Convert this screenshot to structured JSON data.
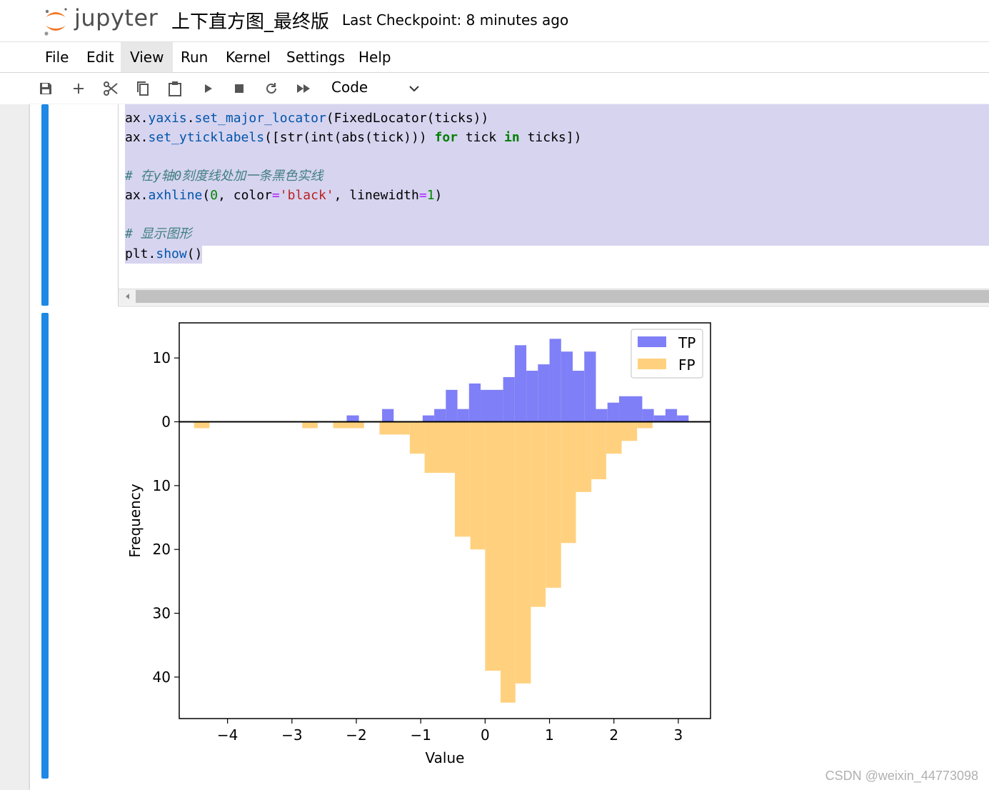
{
  "header": {
    "logo_text": "jupyter",
    "notebook_title": "上下直方图_最终版",
    "checkpoint": "Last Checkpoint: 8 minutes ago"
  },
  "menu": {
    "items": [
      {
        "label": "File"
      },
      {
        "label": "Edit"
      },
      {
        "label": "View"
      },
      {
        "label": "Run"
      },
      {
        "label": "Kernel"
      },
      {
        "label": "Settings"
      },
      {
        "label": "Help"
      }
    ]
  },
  "toolbar": {
    "icons": [
      "save-icon",
      "add-cell-icon",
      "cut-icon",
      "copy-icon",
      "paste-icon",
      "run-icon",
      "stop-icon",
      "restart-icon",
      "run-all-icon"
    ],
    "cell_type": "Code"
  },
  "code": {
    "lines": {
      "l1": {
        "a": "ax.",
        "b": "yaxis",
        "c": ".",
        "d": "set_major_locator",
        "e": "(FixedLocator(ticks))"
      },
      "l2": {
        "a": "ax.",
        "b": "set_yticklabels",
        "c": "([str(int(abs(tick))) ",
        "d": "for",
        "e": " tick ",
        "f": "in",
        "g": " ticks])"
      },
      "l3": "",
      "l4": {
        "comment": "# 在y轴0刻度线处加一条黑色实线"
      },
      "l5": {
        "a": "ax.",
        "b": "axhline",
        "c": "(",
        "d": "0",
        "e": ", color",
        "f": "=",
        "g": "'black'",
        "h": ", linewidth",
        "i": "=",
        "j": "1",
        "k": ")"
      },
      "l6": "",
      "l7": {
        "comment": "# 显示图形"
      },
      "l8": {
        "a": "plt.",
        "b": "show",
        "c": "()"
      }
    }
  },
  "chart_data": {
    "type": "bar",
    "xlabel": "Value",
    "ylabel": "Frequency",
    "xlim": [
      -4.75,
      3.5
    ],
    "ylim": [
      -46.5,
      15.5
    ],
    "xticks": [
      -4,
      -3,
      -2,
      -1,
      0,
      1,
      2,
      3
    ],
    "xticklabels": [
      "−4",
      "−3",
      "−2",
      "−1",
      "0",
      "1",
      "2",
      "3"
    ],
    "yticks": [
      10,
      0,
      -10,
      -20,
      -30,
      -40
    ],
    "yticklabels": [
      "10",
      "0",
      "10",
      "20",
      "30",
      "40"
    ],
    "legend": {
      "position": "top-right",
      "entries": [
        "TP",
        "FP"
      ]
    },
    "series": [
      {
        "name": "TP",
        "color": "#7f7ff7",
        "bins": [
          [
            -2.15,
            -1.96,
            1
          ],
          [
            -1.6,
            -1.42,
            2
          ],
          [
            -0.97,
            -0.79,
            1
          ],
          [
            -0.79,
            -0.61,
            2
          ],
          [
            -0.61,
            -0.43,
            5
          ],
          [
            -0.43,
            -0.25,
            2
          ],
          [
            -0.25,
            -0.07,
            6
          ],
          [
            -0.07,
            0.28,
            5
          ],
          [
            0.28,
            0.46,
            7
          ],
          [
            0.46,
            0.64,
            12
          ],
          [
            0.64,
            0.82,
            8
          ],
          [
            0.82,
            1.0,
            9
          ],
          [
            1.0,
            1.18,
            13
          ],
          [
            1.18,
            1.36,
            11
          ],
          [
            1.36,
            1.54,
            8
          ],
          [
            1.54,
            1.72,
            11
          ],
          [
            1.72,
            1.9,
            2
          ],
          [
            1.9,
            2.08,
            3
          ],
          [
            2.08,
            2.44,
            4
          ],
          [
            2.44,
            2.62,
            2
          ],
          [
            2.62,
            2.8,
            1
          ],
          [
            2.8,
            2.98,
            2
          ],
          [
            2.98,
            3.16,
            1
          ]
        ]
      },
      {
        "name": "FP",
        "color": "#ffd17f",
        "bins": [
          [
            -4.52,
            -4.28,
            -1
          ],
          [
            -2.84,
            -2.6,
            -1
          ],
          [
            -2.36,
            -1.88,
            -1
          ],
          [
            -1.64,
            -1.17,
            -2
          ],
          [
            -1.17,
            -0.94,
            -5
          ],
          [
            -0.94,
            -0.47,
            -8
          ],
          [
            -0.47,
            -0.23,
            -18
          ],
          [
            -0.23,
            0.0,
            -20
          ],
          [
            0.0,
            0.24,
            -39
          ],
          [
            0.24,
            0.47,
            -44
          ],
          [
            0.47,
            0.71,
            -41
          ],
          [
            0.71,
            0.94,
            -29
          ],
          [
            0.94,
            1.18,
            -26
          ],
          [
            1.18,
            1.41,
            -19
          ],
          [
            1.41,
            1.65,
            -11
          ],
          [
            1.65,
            1.88,
            -9
          ],
          [
            1.88,
            2.12,
            -5
          ],
          [
            2.12,
            2.36,
            -3
          ],
          [
            2.36,
            2.6,
            -1
          ]
        ]
      }
    ]
  },
  "watermark": "CSDN @weixin_44773098"
}
